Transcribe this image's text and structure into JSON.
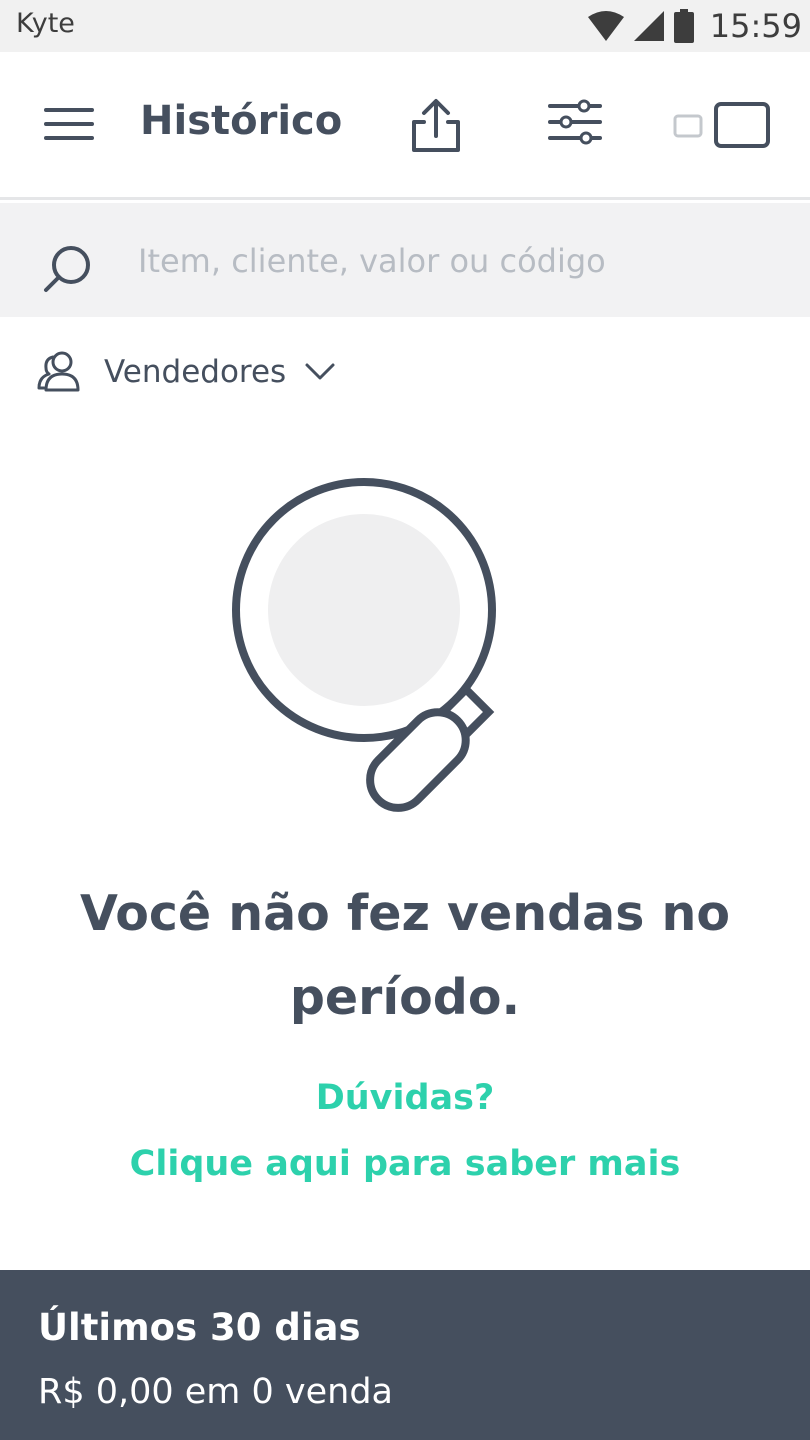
{
  "status_bar": {
    "app_name": "Kyte",
    "time": "15:59",
    "icons": [
      "wifi-icon",
      "signal-icon",
      "battery-icon"
    ]
  },
  "header": {
    "title": "Histórico",
    "icons": [
      "menu-icon",
      "export-icon",
      "filter-icon",
      "view-toggle-icon"
    ]
  },
  "search": {
    "placeholder": "Item, cliente, valor ou código",
    "value": ""
  },
  "sellers_filter": {
    "label": "Vendedores"
  },
  "empty_state": {
    "message": "Você não fez vendas no período.",
    "help_question": "Dúvidas?",
    "help_link": "Clique aqui para saber mais"
  },
  "footer": {
    "period": "Últimos 30 dias",
    "summary": "R$ 0,00 em 0 venda"
  },
  "colors": {
    "primary_text": "#454f5e",
    "accent": "#2dd1ac",
    "footer_bg": "#454f5e",
    "search_bg": "#f2f2f3"
  }
}
